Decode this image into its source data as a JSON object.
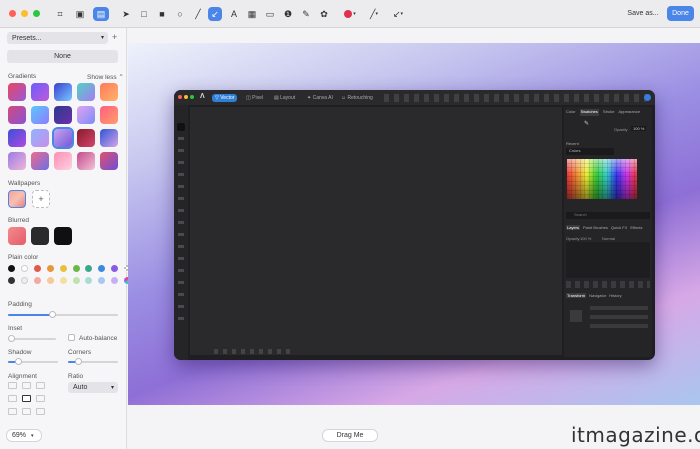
{
  "toolbar": {
    "save_as": "Save as...",
    "done": "Done",
    "accent": "#4a86e8",
    "icons": [
      "crop-icon",
      "screenshot-icon",
      "background-icon",
      "pointer-icon",
      "rectangle-icon",
      "filled-rectangle-icon",
      "circle-icon",
      "line-icon",
      "arrow-icon",
      "text-icon",
      "pixelate-icon",
      "highlight-icon",
      "counter-icon",
      "pen-icon",
      "stamp-icon",
      "color-icon",
      "stroke-icon",
      "style-icon"
    ]
  },
  "sidebar": {
    "presets_label": "Presets...",
    "none_label": "None",
    "gradients_label": "Gradients",
    "show_less": "Show less",
    "wallpapers_label": "Wallpapers",
    "blurred_label": "Blurred",
    "plain_color_label": "Plain color",
    "padding_label": "Padding",
    "padding_value": 0.4,
    "inset_label": "Inset",
    "inset_value": 0.0,
    "auto_balance_label": "Auto-balance",
    "shadow_label": "Shadow",
    "shadow_value": 0.2,
    "corners_label": "Corners",
    "corners_value": 0.2,
    "alignment_label": "Alignment",
    "ratio_label": "Ratio",
    "ratio_value": "Auto",
    "gradients": [
      [
        "#e8465f",
        "#9b59d8"
      ],
      [
        "#6a5cff",
        "#c25ad8"
      ],
      [
        "#3a3fd1",
        "#7ac7ff"
      ],
      [
        "#52d1c4",
        "#a57bf2"
      ],
      [
        "#ff7a59",
        "#ffb36b"
      ],
      [
        "#d24a7a",
        "#8b52d6"
      ],
      [
        "#5ac8fa",
        "#8f7bff"
      ],
      [
        "#2a3b8f",
        "#6d2fa8"
      ],
      [
        "#e0a3f2",
        "#7d8cf7"
      ],
      [
        "#ff5e7e",
        "#ff9f6b"
      ],
      [
        "#3b4fd8",
        "#b04be0"
      ],
      [
        "#8fb3ff",
        "#c88fe8"
      ],
      [
        "#c9a4f0",
        "#7358d8"
      ],
      [
        "#8b1a2e",
        "#d2456b"
      ],
      [
        "#2d55d6",
        "#d6a4e8"
      ],
      [
        "#9b7be8",
        "#f0b6d6"
      ],
      [
        "#f06a8a",
        "#6a6fe8"
      ],
      [
        "#ff8db3",
        "#ffd3e3"
      ],
      [
        "#c34a8a",
        "#f2c3d8"
      ],
      [
        "#e0506e",
        "#6e4fd8"
      ]
    ],
    "colors_row1": [
      "#111111",
      "#ffffff",
      "#e05a4a",
      "#e8963a",
      "#e8c040",
      "#6ab84a",
      "#3aa88a",
      "#3a8ae0",
      "#8a5ae0",
      "checker"
    ],
    "colors_row2": [
      "#333333",
      "#eeeeee",
      "#f3a8a0",
      "#f6c89a",
      "#f3e0a0",
      "#bfe3ae",
      "#a8ddd0",
      "#a8c8f0",
      "#c8b0f0",
      "rainbow"
    ]
  },
  "app_window": {
    "tabs": [
      "Vector",
      "Pixel",
      "Layout",
      "Canva AI",
      "Retouching"
    ],
    "panel_tabs": [
      "Color",
      "Swatches",
      "Stroke",
      "Appearance"
    ],
    "opacity_label": "Opacity",
    "opacity_value": "100 %",
    "recent_label": "Recent",
    "palette_name": "Colors",
    "search_placeholder": "Search",
    "layers_tabs": [
      "Layers",
      "Paint Brushes",
      "Quick FX",
      "Effects"
    ],
    "layers_opacity_label": "Opacity",
    "layers_opacity_value": "100 %",
    "layers_blend_value": "Normal",
    "transform_tabs": [
      "Transform",
      "Navigator",
      "History"
    ]
  },
  "bottom": {
    "zoom": "69%",
    "drag_me": "Drag Me"
  },
  "watermark": "itmagazine.oc"
}
